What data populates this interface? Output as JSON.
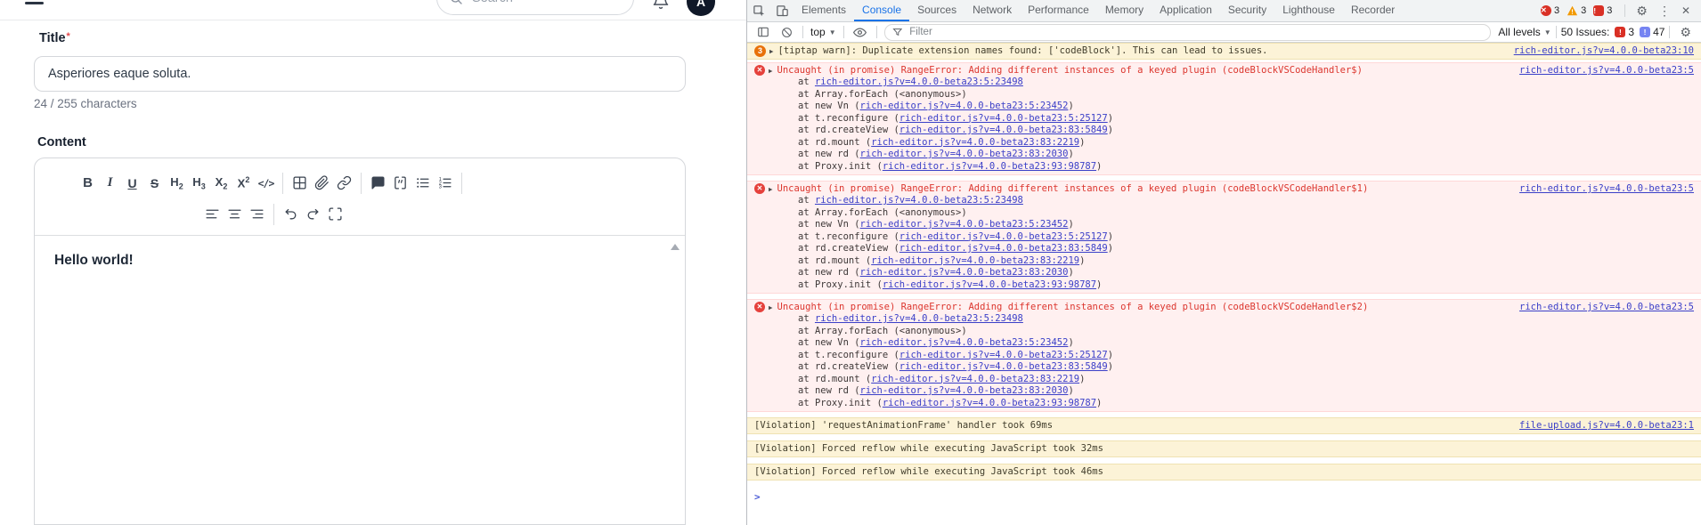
{
  "page": {
    "search": {
      "placeholder": "Search"
    },
    "avatar_text": "A",
    "form": {
      "title_label": "Title",
      "required_marker": "*",
      "title_value": "Asperiores eaque soluta.",
      "char_counter": "24 / 255 characters",
      "content_label": "Content",
      "editor_text": "Hello world!",
      "toolbar_row1": [
        "bold",
        "italic",
        "underline",
        "strikethrough",
        "h2",
        "h3",
        "subscript",
        "superscript",
        "code",
        "divider",
        "table",
        "attachment",
        "link",
        "divider",
        "comment",
        "code-block",
        "bullet-list",
        "ordered-list",
        "divider"
      ],
      "toolbar_row2": [
        "align-left",
        "align-center",
        "align-right",
        "divider",
        "undo",
        "redo",
        "fullscreen"
      ]
    }
  },
  "devtools": {
    "tabs": [
      {
        "label": "Elements",
        "active": false
      },
      {
        "label": "Console",
        "active": true
      },
      {
        "label": "Sources",
        "active": false
      },
      {
        "label": "Network",
        "active": false
      },
      {
        "label": "Performance",
        "active": false
      },
      {
        "label": "Memory",
        "active": false
      },
      {
        "label": "Application",
        "active": false
      },
      {
        "label": "Security",
        "active": false
      },
      {
        "label": "Lighthouse",
        "active": false
      },
      {
        "label": "Recorder",
        "active": false
      }
    ],
    "top_badges": {
      "errors": "3",
      "warnings": "3",
      "issues": "3"
    },
    "console_toolbar": {
      "context": "top",
      "filter_placeholder": "Filter",
      "levels_label": "All levels",
      "issues_label": "50 Issues:",
      "issues_red": "3",
      "issues_blue": "47"
    },
    "messages": [
      {
        "type": "warning",
        "badge": "3",
        "text": "[tiptap warn]: Duplicate extension names found: ['codeBlock']. This can lead to issues.",
        "source": "rich-editor.js?v=4.0.0-beta23:10"
      },
      {
        "type": "error",
        "text": "Uncaught (in promise) RangeError: Adding different instances of a keyed plugin (codeBlockVSCodeHandler$)",
        "source": "rich-editor.js?v=4.0.0-beta23:5",
        "stack": [
          {
            "pre": "at ",
            "link": "rich-editor.js?v=4.0.0-beta23:5:23498",
            "post": ""
          },
          {
            "pre": "at Array.forEach (<anonymous>)",
            "link": "",
            "post": ""
          },
          {
            "pre": "at new Vn (",
            "link": "rich-editor.js?v=4.0.0-beta23:5:23452",
            "post": ")"
          },
          {
            "pre": "at t.reconfigure (",
            "link": "rich-editor.js?v=4.0.0-beta23:5:25127",
            "post": ")"
          },
          {
            "pre": "at rd.createView (",
            "link": "rich-editor.js?v=4.0.0-beta23:83:5849",
            "post": ")"
          },
          {
            "pre": "at rd.mount (",
            "link": "rich-editor.js?v=4.0.0-beta23:83:2219",
            "post": ")"
          },
          {
            "pre": "at new rd (",
            "link": "rich-editor.js?v=4.0.0-beta23:83:2030",
            "post": ")"
          },
          {
            "pre": "at Proxy.init (",
            "link": "rich-editor.js?v=4.0.0-beta23:93:98787",
            "post": ")"
          }
        ]
      },
      {
        "type": "error",
        "text": "Uncaught (in promise) RangeError: Adding different instances of a keyed plugin (codeBlockVSCodeHandler$1)",
        "source": "rich-editor.js?v=4.0.0-beta23:5",
        "stack": [
          {
            "pre": "at ",
            "link": "rich-editor.js?v=4.0.0-beta23:5:23498",
            "post": ""
          },
          {
            "pre": "at Array.forEach (<anonymous>)",
            "link": "",
            "post": ""
          },
          {
            "pre": "at new Vn (",
            "link": "rich-editor.js?v=4.0.0-beta23:5:23452",
            "post": ")"
          },
          {
            "pre": "at t.reconfigure (",
            "link": "rich-editor.js?v=4.0.0-beta23:5:25127",
            "post": ")"
          },
          {
            "pre": "at rd.createView (",
            "link": "rich-editor.js?v=4.0.0-beta23:83:5849",
            "post": ")"
          },
          {
            "pre": "at rd.mount (",
            "link": "rich-editor.js?v=4.0.0-beta23:83:2219",
            "post": ")"
          },
          {
            "pre": "at new rd (",
            "link": "rich-editor.js?v=4.0.0-beta23:83:2030",
            "post": ")"
          },
          {
            "pre": "at Proxy.init (",
            "link": "rich-editor.js?v=4.0.0-beta23:93:98787",
            "post": ")"
          }
        ]
      },
      {
        "type": "error",
        "text": "Uncaught (in promise) RangeError: Adding different instances of a keyed plugin (codeBlockVSCodeHandler$2)",
        "source": "rich-editor.js?v=4.0.0-beta23:5",
        "stack": [
          {
            "pre": "at ",
            "link": "rich-editor.js?v=4.0.0-beta23:5:23498",
            "post": ""
          },
          {
            "pre": "at Array.forEach (<anonymous>)",
            "link": "",
            "post": ""
          },
          {
            "pre": "at new Vn (",
            "link": "rich-editor.js?v=4.0.0-beta23:5:23452",
            "post": ")"
          },
          {
            "pre": "at t.reconfigure (",
            "link": "rich-editor.js?v=4.0.0-beta23:5:25127",
            "post": ")"
          },
          {
            "pre": "at rd.createView (",
            "link": "rich-editor.js?v=4.0.0-beta23:83:5849",
            "post": ")"
          },
          {
            "pre": "at rd.mount (",
            "link": "rich-editor.js?v=4.0.0-beta23:83:2219",
            "post": ")"
          },
          {
            "pre": "at new rd (",
            "link": "rich-editor.js?v=4.0.0-beta23:83:2030",
            "post": ")"
          },
          {
            "pre": "at Proxy.init (",
            "link": "rich-editor.js?v=4.0.0-beta23:93:98787",
            "post": ")"
          }
        ]
      },
      {
        "type": "violation",
        "text": "[Violation] 'requestAnimationFrame' handler took 69ms",
        "source": "file-upload.js?v=4.0.0-beta23:1"
      },
      {
        "type": "violation",
        "text": "[Violation] Forced reflow while executing JavaScript took 32ms",
        "source": ""
      },
      {
        "type": "violation",
        "text": "[Violation] Forced reflow while executing JavaScript took 46ms",
        "source": ""
      }
    ],
    "prompt_glyph": ">"
  },
  "colors": {
    "accent_blue": "#1a73e8",
    "error_text": "#dc362e",
    "error_bg": "#fff0f0",
    "warning_bg": "#fcf3d7",
    "link": "#3b40c8",
    "badge_orange": "#e8710a",
    "badge_red": "#d93025",
    "issues_blue": "#7684f2",
    "avatar_bg": "#101828"
  }
}
